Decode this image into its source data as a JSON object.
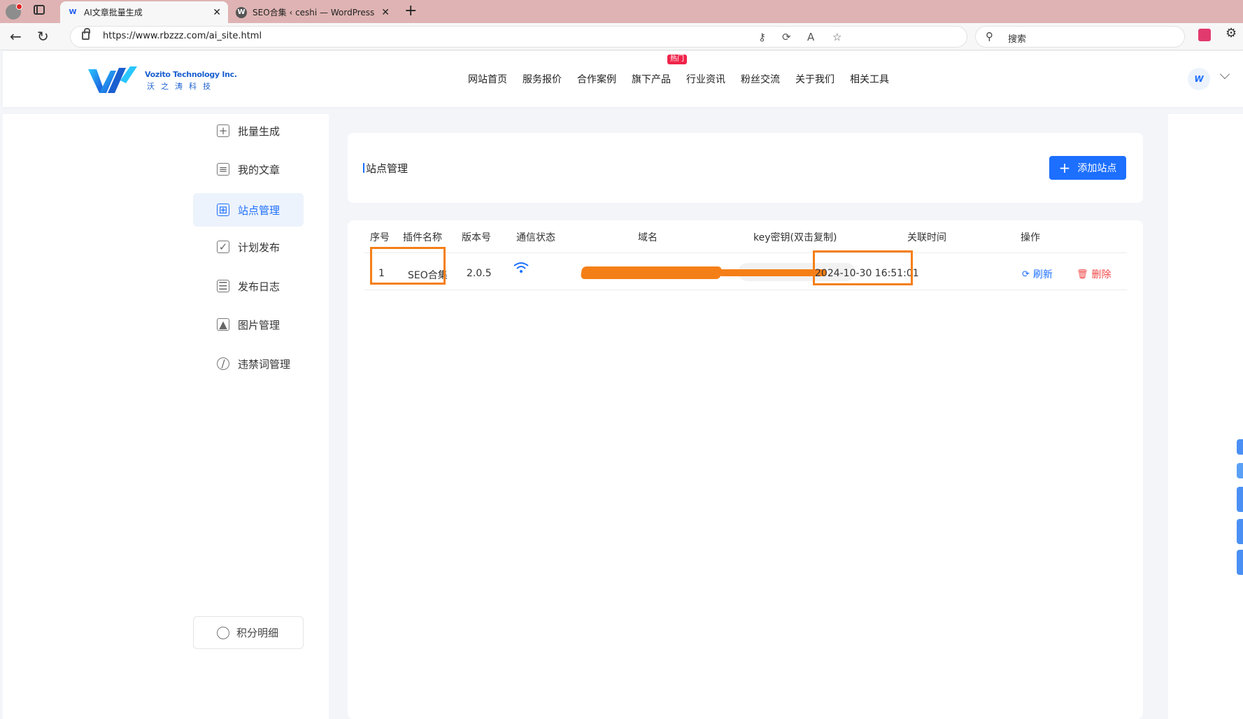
{
  "browser": {
    "tabs": [
      {
        "title": "AI文章批量生成",
        "favicon": "W",
        "active": true
      },
      {
        "title": "SEO合集 ‹ ceshi — WordPress",
        "favicon": "W",
        "active": false
      }
    ],
    "url": "https://www.rbzzz.com/ai_site.html",
    "search_placeholder": "搜索"
  },
  "header": {
    "logo_en": "Vozito Technology Inc.",
    "logo_cn": "沃之涛科技",
    "nav": [
      "网站首页",
      "服务报价",
      "合作案例",
      "旗下产品",
      "行业资讯",
      "粉丝交流",
      "关于我们",
      "相关工具"
    ],
    "hot_badge": "热门",
    "avatar_letter": "W"
  },
  "sidebar": {
    "items": [
      {
        "label": "批量生成",
        "icon": "plus-square-icon"
      },
      {
        "label": "我的文章",
        "icon": "document-icon"
      },
      {
        "label": "站点管理",
        "icon": "sitemap-icon",
        "active": true
      },
      {
        "label": "计划发布",
        "icon": "calendar-check-icon"
      },
      {
        "label": "发布日志",
        "icon": "log-list-icon"
      },
      {
        "label": "图片管理",
        "icon": "image-icon"
      },
      {
        "label": "违禁词管理",
        "icon": "prohibited-icon"
      }
    ],
    "points_label": "积分明细"
  },
  "main": {
    "title": "站点管理",
    "add_button": "添加站点",
    "columns": [
      "序号",
      "插件名称",
      "版本号",
      "通信状态",
      "域名",
      "key密钥(双击复制)",
      "关联时间",
      "操作"
    ],
    "rows": [
      {
        "index": "1",
        "plugin": "SEO合集",
        "version": "2.0.5",
        "status": "connected",
        "domain": "",
        "key": "",
        "time": "2024-10-30 16:51:01"
      }
    ],
    "actions": {
      "refresh": "刷新",
      "delete": "删除"
    }
  },
  "colors": {
    "accent": "#1c6fff",
    "highlight": "#f57f17",
    "danger": "#f04646",
    "tab_strip": "#dfb3b3"
  }
}
